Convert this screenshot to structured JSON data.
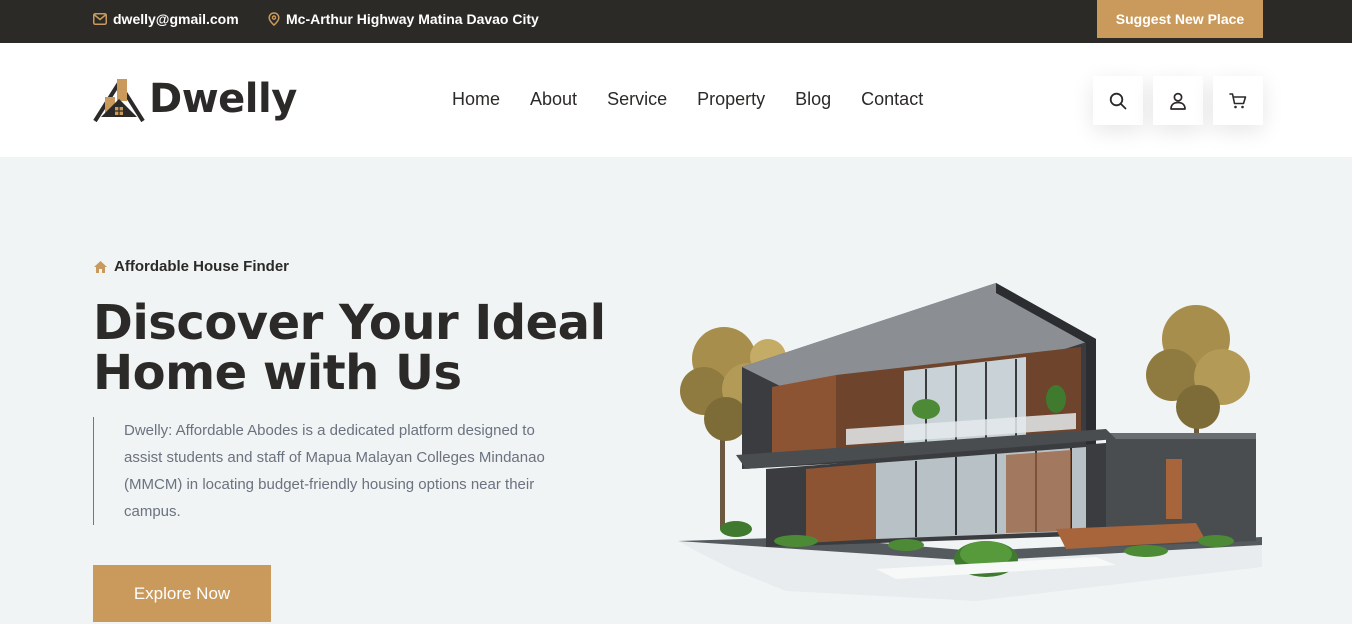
{
  "topbar": {
    "email": "dwelly@gmail.com",
    "address": "Mc-Arthur Highway Matina Davao City",
    "suggest_label": "Suggest New Place"
  },
  "brand": {
    "name": "Dwelly"
  },
  "nav": {
    "items": [
      {
        "label": "Home"
      },
      {
        "label": "About"
      },
      {
        "label": "Service"
      },
      {
        "label": "Property"
      },
      {
        "label": "Blog"
      },
      {
        "label": "Contact"
      }
    ]
  },
  "icons": [
    "search-icon",
    "user-icon",
    "cart-icon"
  ],
  "hero": {
    "eyebrow": "Affordable House Finder",
    "title_line1": "Discover Your Ideal",
    "title_line2": "Home with Us",
    "description": "Dwelly: Affordable Abodes is a dedicated platform designed to assist students and staff of Mapua Malayan Colleges Mindanao (MMCM) in locating budget-friendly housing options near their campus.",
    "cta_label": "Explore Now"
  },
  "colors": {
    "accent": "#c99a5b",
    "dark": "#2c2a26",
    "hero_bg": "#f1f4f4"
  }
}
